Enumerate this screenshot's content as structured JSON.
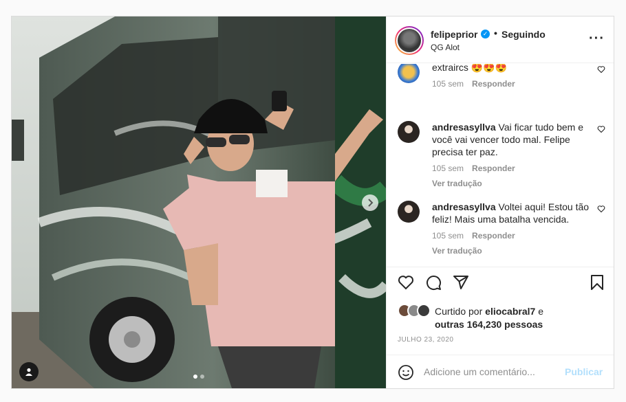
{
  "post": {
    "media_alt_icon": "photo",
    "carousel_count": 2,
    "carousel_active": 0
  },
  "header": {
    "username": "felipeprior",
    "separator": "•",
    "follow_label": "Seguindo",
    "location": "QG Alot",
    "more_icon": "more-dots-icon"
  },
  "comments": [
    {
      "username": "",
      "text": "extraircs 😍😍😍",
      "time": "105 sem",
      "reply_label": "Responder",
      "translate_label": ""
    },
    {
      "username": "andresasyllva",
      "text": "Vai ficar tudo bem e você vai vencer todo mal. Felipe precisa ter paz.",
      "time": "105 sem",
      "reply_label": "Responder",
      "translate_label": "Ver tradução"
    },
    {
      "username": "andresasyllva",
      "text": "Voltei aqui! Estou tão feliz! Mais uma batalha vencida.",
      "time": "105 sem",
      "reply_label": "Responder",
      "translate_label": "Ver tradução"
    }
  ],
  "likes": {
    "prefix": "Curtido por",
    "user": "eliocabral7",
    "joiner": "e",
    "others": "outras 164,230 pessoas"
  },
  "date": "JULHO 23, 2020",
  "composer": {
    "placeholder": "Adicione um comentário...",
    "publish_label": "Publicar"
  },
  "colors": {
    "accent": "#0095f6",
    "publish_disabled": "#b2dffc",
    "muted": "#8e8e8e"
  }
}
